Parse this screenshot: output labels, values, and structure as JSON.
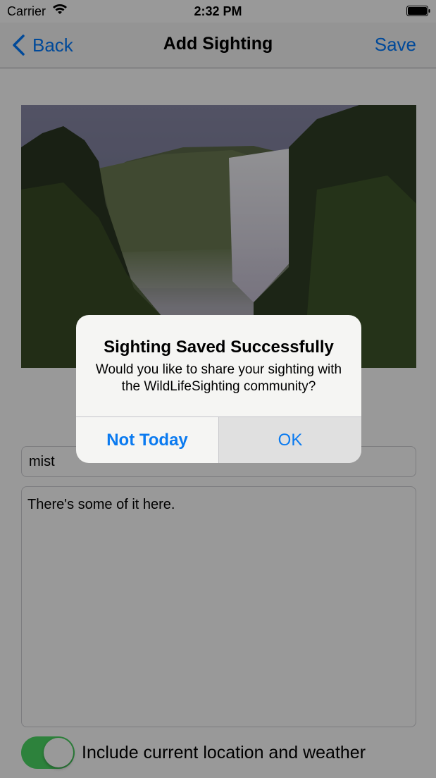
{
  "status_bar": {
    "carrier": "Carrier",
    "time": "2:32 PM"
  },
  "nav": {
    "back_label": "Back",
    "title": "Add Sighting",
    "save_label": "Save"
  },
  "form": {
    "title_value": "mist",
    "notes_value": "There's some of it here.",
    "location_toggle_label": "Include current location and weather",
    "location_toggle_on": true
  },
  "alert": {
    "title": "Sighting Saved Successfully",
    "message": "Would you like to share your sighting with the WildLifeSighting community?",
    "cancel_label": "Not Today",
    "ok_label": "OK"
  },
  "colors": {
    "tint": "#007aff",
    "toggle_on": "#4cd964"
  },
  "icons": [
    "wifi-icon",
    "battery-icon",
    "chevron-left-icon"
  ]
}
